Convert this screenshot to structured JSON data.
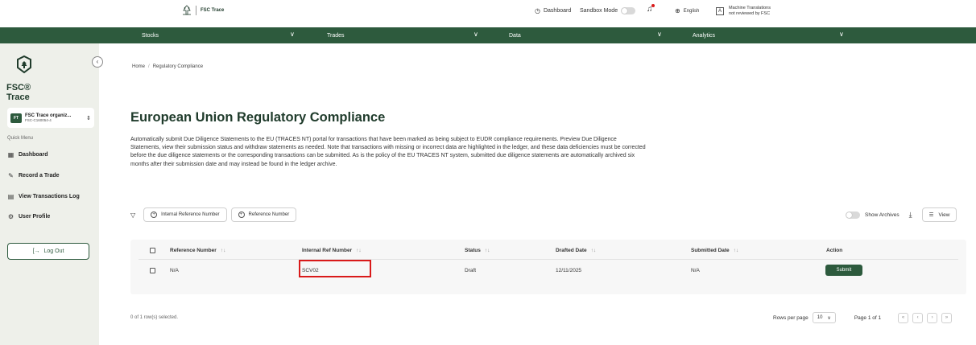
{
  "header": {
    "logo_text": "FSC Trace",
    "dashboard_label": "Dashboard",
    "sandbox_label": "Sandbox Mode",
    "language_label": "English",
    "mt_line1": "Machine Translations",
    "mt_line2": "not reviewed by FSC"
  },
  "nav": {
    "items": [
      {
        "label": "Stocks"
      },
      {
        "label": "Trades"
      },
      {
        "label": "Data"
      },
      {
        "label": "Analytics"
      }
    ],
    "chevron": "∨"
  },
  "sidebar": {
    "brand": "FSC® Trace",
    "collapse_icon": "‹",
    "org": {
      "avatar": "FT",
      "name": "FSC Trace organiz...",
      "id": "FSC-C160054-4"
    },
    "quick_menu": "Quick Menu",
    "items": [
      {
        "label": "Dashboard",
        "icon": "▦"
      },
      {
        "label": "Record a Trade",
        "icon": "✎"
      },
      {
        "label": "View Transactions Log",
        "icon": "▤"
      },
      {
        "label": "User Profile",
        "icon": "⚙"
      }
    ],
    "logout": "Log Out",
    "logout_icon": "[→"
  },
  "breadcrumb": {
    "home": "Home",
    "current": "Regulatory Compliance"
  },
  "page": {
    "title": "European Union Regulatory Compliance",
    "description": "Automatically submit Due Diligence Statements to the EU (TRACES NT) portal for transactions that have been marked as being subject to EUDR compliance requirements. Preview Due Diligence Statements, view their submission status and withdraw statements as needed. Note that transactions with missing or incorrect data are highlighted in the ledger, and these data deficiencies must be corrected before the due diligence statements or the corresponding transactions can be submitted. As is the policy of the EU TRACES NT system, submitted due diligence statements are automatically archived six months after their submission date and may instead be found in the ledger archive."
  },
  "filters": {
    "chip1": "Internal Reference Number",
    "chip2": "Reference Number",
    "show_archives": "Show Archives",
    "view": "View"
  },
  "table": {
    "columns": [
      "Reference Number",
      "Internal Ref Number",
      "Status",
      "Drafted Date",
      "Submitted Date",
      "Action"
    ],
    "sort_icon": "↑↓",
    "rows": [
      {
        "reference": "N/A",
        "internal_ref": "SCV02",
        "status": "Draft",
        "drafted": "12/11/2025",
        "submitted": "N/A",
        "action": "Submit"
      }
    ]
  },
  "footer": {
    "selected": "0 of 1 row(s) selected.",
    "rows_per_page_label": "Rows per page",
    "rows_per_page_value": "10",
    "page_label": "Page 1 of 1"
  },
  "colors": {
    "primary": "#2d5a3d",
    "highlight": "#d91a1a",
    "sidebar_bg": "#eef0ea"
  }
}
